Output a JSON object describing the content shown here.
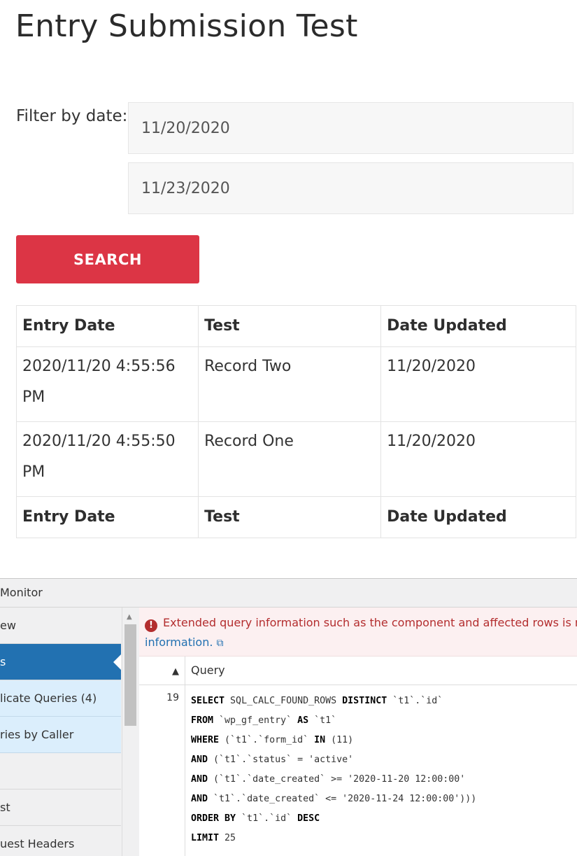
{
  "page": {
    "title": "Entry Submission Test",
    "filter_label": "Filter by date:",
    "date_from": "11/20/2020",
    "date_to": "11/23/2020",
    "search_label": "SEARCH"
  },
  "table": {
    "headers": [
      "Entry Date",
      "Test",
      "Date Updated"
    ],
    "rows": [
      [
        "2020/11/20 4:55:56 PM",
        "Record Two",
        "11/20/2020"
      ],
      [
        "2020/11/20 4:55:50 PM",
        "Record One",
        "11/20/2020"
      ]
    ],
    "footers": [
      "Entry Date",
      "Test",
      "Date Updated"
    ]
  },
  "qm": {
    "title": "Monitor",
    "nav": [
      {
        "label": "ew",
        "state": "normal"
      },
      {
        "label": "s",
        "state": "active"
      },
      {
        "label": "licate Queries (4)",
        "state": "light"
      },
      {
        "label": "ries by Caller",
        "state": "light"
      },
      {
        "label": "",
        "state": "blank"
      },
      {
        "label": "st",
        "state": "normal"
      },
      {
        "label": "uest Headers",
        "state": "normal"
      }
    ],
    "notice_text": "Extended query information such as the component and affected rows is n",
    "notice_link": "information.",
    "column_query": "Query",
    "row_number": "19",
    "sql_lines": [
      {
        "kw": "SELECT",
        "rest": " SQL_CALC_FOUND_ROWS ",
        "kw2": "DISTINCT",
        "rest2": " `t1`.`id`"
      },
      {
        "kw": "FROM",
        "rest": " `wp_gf_entry` ",
        "kw2": "AS",
        "rest2": " `t1`"
      },
      {
        "kw": "WHERE",
        "rest": " (`t1`.`form_id` ",
        "kw2": "IN",
        "rest2": " (11)"
      },
      {
        "kw": "AND",
        "rest": " (`t1`.`status` = 'active'",
        "kw2": "",
        "rest2": ""
      },
      {
        "kw": "AND",
        "rest": " (`t1`.`date_created` >= '2020-11-20 12:00:00'",
        "kw2": "",
        "rest2": ""
      },
      {
        "kw": "AND",
        "rest": " `t1`.`date_created` <= '2020-11-24 12:00:00')))",
        "kw2": "",
        "rest2": ""
      },
      {
        "kw": "ORDER BY",
        "rest": " `t1`.`id` ",
        "kw2": "DESC",
        "rest2": ""
      },
      {
        "kw": "LIMIT",
        "rest": " 25",
        "kw2": "",
        "rest2": ""
      }
    ]
  },
  "colors": {
    "accent": "#dc3545",
    "qm_active": "#2271b1",
    "qm_error": "#b32d2e"
  }
}
